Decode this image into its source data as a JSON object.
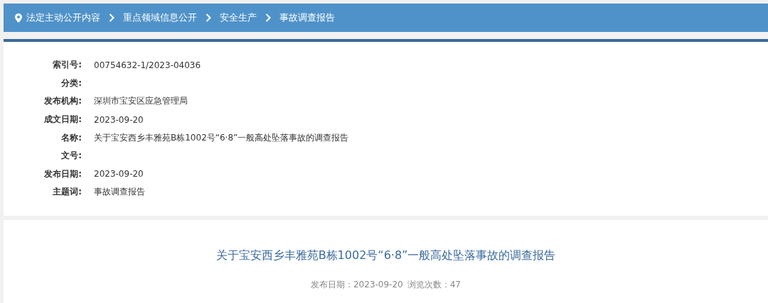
{
  "breadcrumb": [
    {
      "label": "法定主动公开内容"
    },
    {
      "label": "重点领域信息公开"
    },
    {
      "label": "安全生产"
    },
    {
      "label": "事故调查报告"
    }
  ],
  "info": [
    {
      "label": "索引号:",
      "value": "00754632-1/2023-04036"
    },
    {
      "label": "分类:"
    },
    {
      "label": "发布机构:",
      "value": "深圳市宝安区应急管理局"
    },
    {
      "label": "成文日期:",
      "value": "2023-09-20"
    },
    {
      "label": "名称:",
      "value": "关于宝安西乡丰雅苑B栋1002号“6·8”一般高处坠落事故的调查报告"
    },
    {
      "label": "文号:"
    },
    {
      "label": "发布日期:",
      "value": "2023-09-20"
    },
    {
      "label": "主题词:",
      "value": "事故调查报告"
    }
  ],
  "article": {
    "title": "关于宝安西乡丰雅苑B栋1002号“6·8”一般高处坠落事故的调查报告",
    "meta": [
      "发布日期：2023-09-20",
      "浏览次数：47"
    ]
  }
}
